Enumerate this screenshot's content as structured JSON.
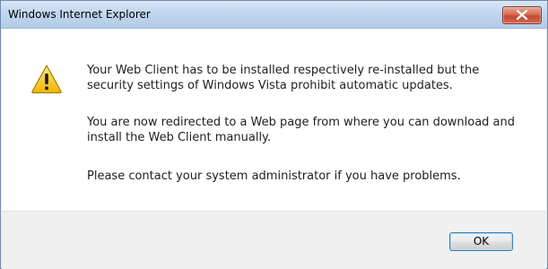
{
  "dialog": {
    "title": "Windows Internet Explorer",
    "icon": "warning-icon",
    "messages": [
      "Your Web Client has to be installed respectively re-installed but the security settings of Windows Vista prohibit automatic updates.",
      "You are now redirected to a Web page from where you can download and install the Web Client manually.",
      "Please contact your system administrator if you have problems."
    ],
    "ok_label": "OK"
  },
  "colors": {
    "titlebar": "#c2d6ee",
    "close_button": "#c04a2f",
    "content_background": "#ffffff",
    "footer_background": "#f0f0f0",
    "warning_yellow": "#f5c400"
  }
}
